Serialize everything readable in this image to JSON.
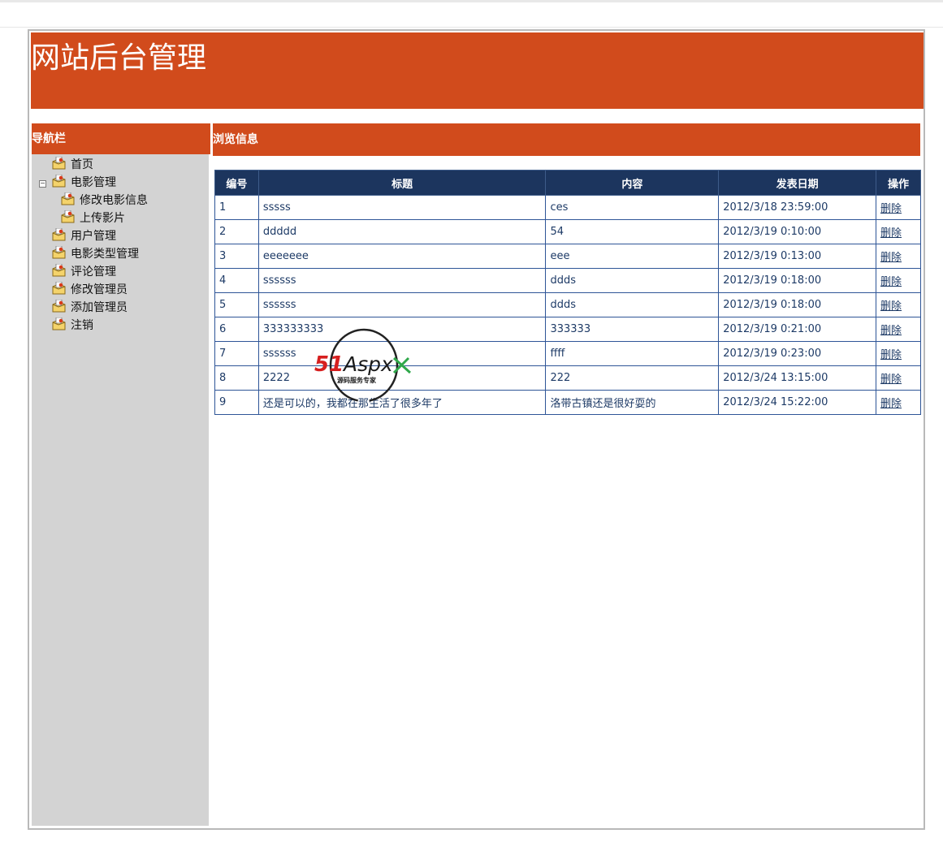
{
  "header": {
    "site_title": "网站后台管理"
  },
  "sidebar": {
    "title": "导航栏",
    "items": [
      {
        "label": "首页",
        "level": 0
      },
      {
        "label": "电影管理",
        "level": 0,
        "expanded": true
      },
      {
        "label": "修改电影信息",
        "level": 1
      },
      {
        "label": "上传影片",
        "level": 1
      },
      {
        "label": "用户管理",
        "level": 0
      },
      {
        "label": "电影类型管理",
        "level": 0
      },
      {
        "label": "评论管理",
        "level": 0
      },
      {
        "label": "修改管理员",
        "level": 0
      },
      {
        "label": "添加管理员",
        "level": 0
      },
      {
        "label": "注销",
        "level": 0
      }
    ]
  },
  "main": {
    "title": "浏览信息",
    "table": {
      "columns": [
        "编号",
        "标题",
        "内容",
        "发表日期",
        "操作"
      ],
      "rows": [
        {
          "id": "1",
          "title": "sssss",
          "content": "ces",
          "date": "2012/3/18 23:59:00",
          "action": "删除"
        },
        {
          "id": "2",
          "title": "ddddd",
          "content": "54",
          "date": "2012/3/19 0:10:00",
          "action": "删除"
        },
        {
          "id": "3",
          "title": "eeeeeee",
          "content": "eee",
          "date": "2012/3/19 0:13:00",
          "action": "删除"
        },
        {
          "id": "4",
          "title": "ssssss",
          "content": "ddds",
          "date": "2012/3/19 0:18:00",
          "action": "删除"
        },
        {
          "id": "5",
          "title": "ssssss",
          "content": "ddds",
          "date": "2012/3/19 0:18:00",
          "action": "删除"
        },
        {
          "id": "6",
          "title": "333333333",
          "content": "333333",
          "date": "2012/3/19 0:21:00",
          "action": "删除"
        },
        {
          "id": "7",
          "title": "ssssss",
          "content": "ffff",
          "date": "2012/3/19 0:23:00",
          "action": "删除"
        },
        {
          "id": "8",
          "title": "2222",
          "content": "222",
          "date": "2012/3/24 13:15:00",
          "action": "删除"
        },
        {
          "id": "9",
          "title": "还是可以的，我都在那生活了很多年了",
          "content": "洛带古镇还是很好耍的",
          "date": "2012/3/24 15:22:00",
          "action": "删除"
        }
      ]
    }
  },
  "watermark": {
    "brand": "51Aspx",
    "tagline": "源码服务专家"
  },
  "colors": {
    "accent": "#d14b1c",
    "table_header": "#1c355e",
    "sidebar_bg": "#d3d3d3",
    "cell_border": "#2e5597"
  },
  "icons": {
    "nav_item": "folder-icon",
    "collapse": "collapse-icon"
  }
}
